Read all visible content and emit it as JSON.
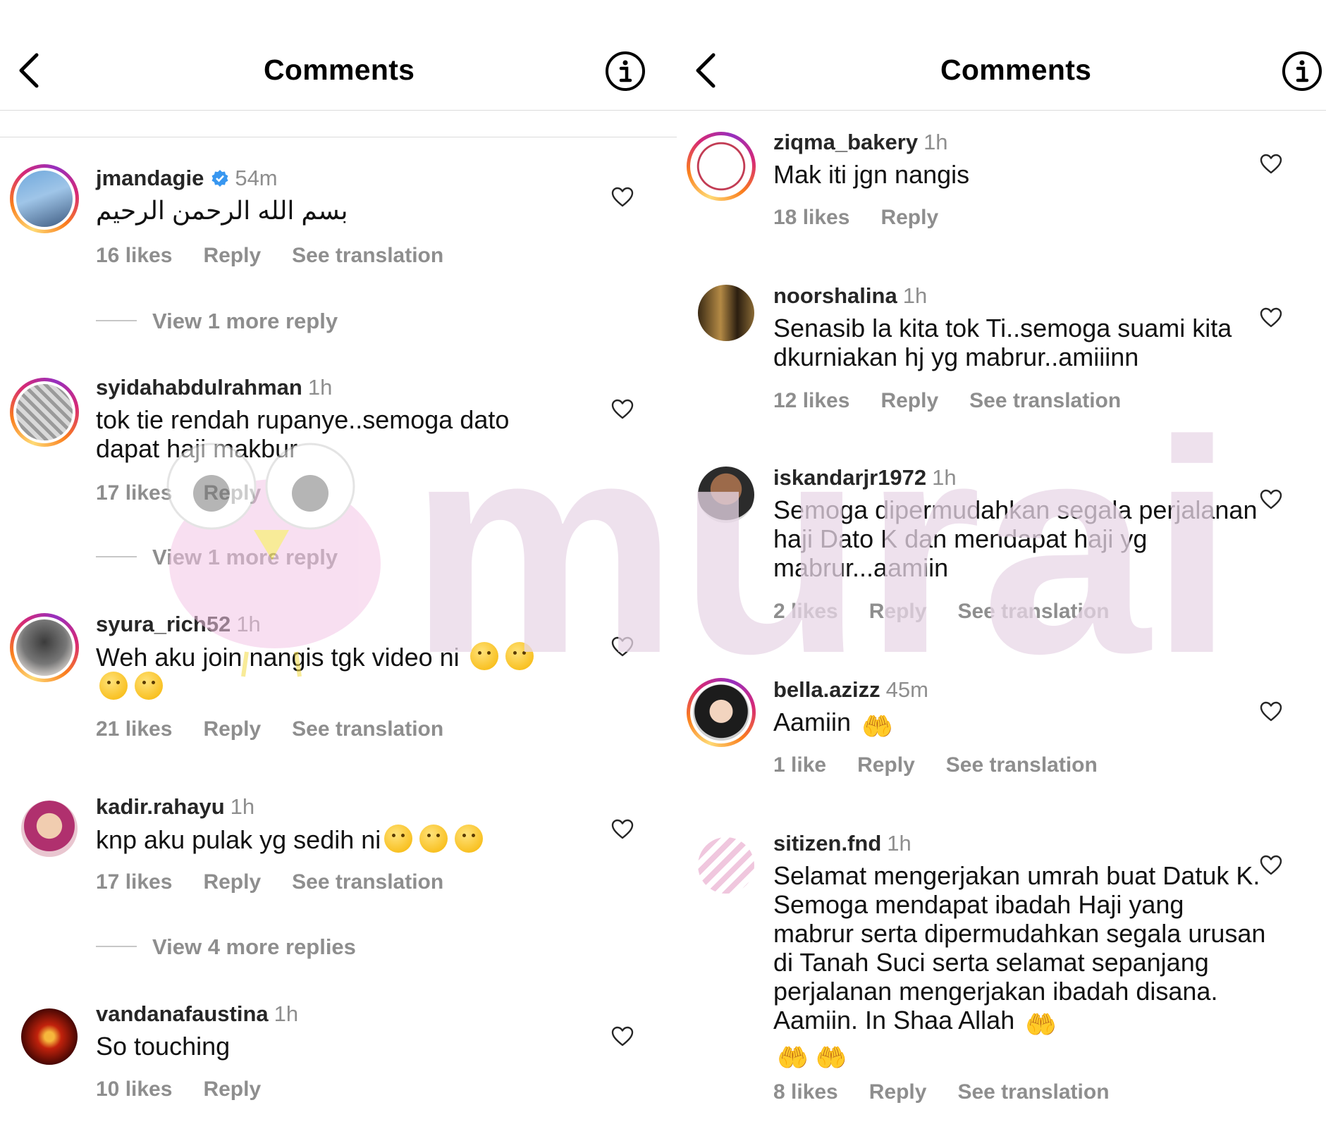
{
  "left": {
    "title": "Comments",
    "comments": [
      {
        "username": "jmandagie",
        "time": "54m",
        "text": "بسم الله الرحمن الرحيم",
        "likes": "16 likes",
        "reply": "Reply",
        "translate": "See translation",
        "verified": true
      },
      {
        "username": "syidahabdulrahman",
        "time": "1h",
        "text": "tok tie rendah rupanye..semoga dato dapat haji makbur",
        "likes": "17 likes",
        "reply": "Reply",
        "translate": ""
      },
      {
        "username": "syura_rich52",
        "time": "1h",
        "text": "Weh aku join nangis tgk video ni",
        "likes": "21 likes",
        "reply": "Reply",
        "translate": "See translation"
      },
      {
        "username": "kadir.rahayu",
        "time": "1h",
        "text": "knp aku pulak yg sedih ni",
        "likes": "17 likes",
        "reply": "Reply",
        "translate": "See translation"
      },
      {
        "username": "vandanafaustina",
        "time": "1h",
        "text": "So touching",
        "likes": "10 likes",
        "reply": "Reply",
        "translate": ""
      }
    ],
    "view_more": [
      "View 1 more reply",
      "View 1 more reply",
      "View 4 more replies"
    ]
  },
  "right": {
    "title": "Comments",
    "comments": [
      {
        "username": "ziqma_bakery",
        "time": "1h",
        "text": "Mak iti jgn nangis",
        "likes": "18 likes",
        "reply": "Reply",
        "translate": ""
      },
      {
        "username": "noorshalina",
        "time": "1h",
        "text": "Senasib la kita tok Ti..semoga suami kita dkurniakan hj yg mabrur..amiiinn",
        "likes": "12 likes",
        "reply": "Reply",
        "translate": "See translation"
      },
      {
        "username": "iskandarjr1972",
        "time": "1h",
        "text": "Semoga dipermudahkan segala perjalanan haji Dato K dan mendapat haji yg mabrur...aamiin",
        "likes": "2 likes",
        "reply": "Reply",
        "translate": "See translation"
      },
      {
        "username": "bella.azizz",
        "time": "45m",
        "text": "Aamiin",
        "likes": "1 like",
        "reply": "Reply",
        "translate": "See translation"
      },
      {
        "username": "sitizen.fnd",
        "time": "1h",
        "text": "Selamat mengerjakan umrah buat Datuk K. Semoga mendapat ibadah Haji yang mabrur serta dipermudahkan segala urusan di Tanah Suci serta selamat sepanjang perjalanan mengerjakan ibadah disana. Aamiin. In Shaa Allah",
        "likes": "8 likes",
        "reply": "Reply",
        "translate": "See translation"
      }
    ]
  },
  "watermark": {
    "text": "murai"
  },
  "colors": {
    "secondary_text": "#8e8e8e",
    "divider": "#dbdbdb",
    "watermark": "#e9d8e8",
    "verified": "#3897f0"
  },
  "icons": [
    "back-chevron-icon",
    "info-icon",
    "heart-outline-icon",
    "verified-badge-icon"
  ]
}
